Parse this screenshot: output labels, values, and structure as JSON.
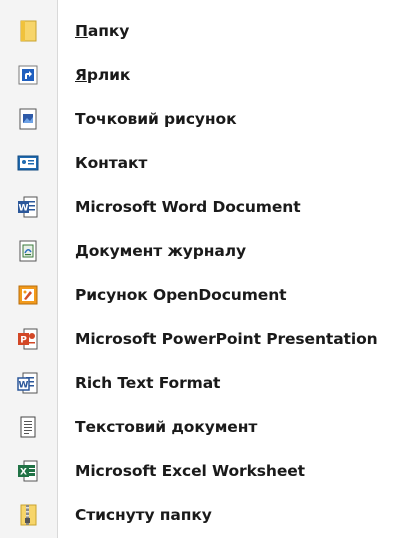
{
  "menu": {
    "items": [
      {
        "label": "Папку",
        "icon": "folder-icon",
        "mnemonic": "П",
        "rest": "апку"
      },
      {
        "label": "Ярлик",
        "icon": "shortcut-icon",
        "mnemonic": "Я",
        "rest": "рлик"
      },
      {
        "label": "Точковий рисунок",
        "icon": "bitmap-image-icon"
      },
      {
        "label": "Контакт",
        "icon": "contact-card-icon"
      },
      {
        "label": "Microsoft Word Document",
        "icon": "word-document-icon"
      },
      {
        "label": "Документ журналу",
        "icon": "journal-document-icon"
      },
      {
        "label": "Рисунок OpenDocument",
        "icon": "opendocument-drawing-icon"
      },
      {
        "label": "Microsoft PowerPoint Presentation",
        "icon": "powerpoint-icon"
      },
      {
        "label": "Rich Text Format",
        "icon": "rich-text-icon"
      },
      {
        "label": "Текстовий документ",
        "icon": "text-document-icon"
      },
      {
        "label": "Microsoft Excel Worksheet",
        "icon": "excel-icon"
      },
      {
        "label": "Стиснуту папку",
        "icon": "zip-folder-icon"
      }
    ]
  },
  "colors": {
    "folder": "#f5c441",
    "shortcut_arrow": "#1f5fbf",
    "word": "#2b579a",
    "powerpoint": "#d24726",
    "excel": "#217346",
    "zip": "#e6b422"
  }
}
